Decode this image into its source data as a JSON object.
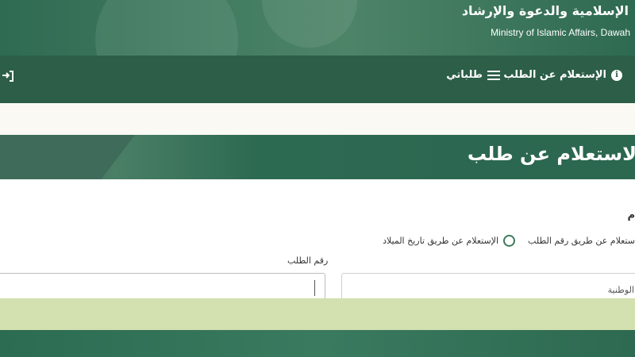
{
  "header": {
    "title_ar": "الإسلامية والدعوة والإرشاد",
    "title_en": "Ministry of Islamic Affairs, Dawah"
  },
  "nav": {
    "items": [
      {
        "label": "الإستعلام عن الطلب",
        "icon": "info-icon"
      },
      {
        "label": "طلباتي",
        "icon": "list-icon"
      }
    ],
    "login_icon": "sign-in-icon"
  },
  "page": {
    "title": "لاستعلام عن طلب",
    "section_mark": "م"
  },
  "form": {
    "radio_options": [
      {
        "label": "ستعلام عن طريق رقم الطلب"
      },
      {
        "label": "الإستعلام عن طريق تاريخ الميلاد"
      }
    ],
    "request_number_label": "رقم الطلب",
    "national_id_placeholder": "الوطنية"
  },
  "colors": {
    "primary": "#2c5e48",
    "accent_bar": "#d3e0b0",
    "background": "#ffffff"
  }
}
